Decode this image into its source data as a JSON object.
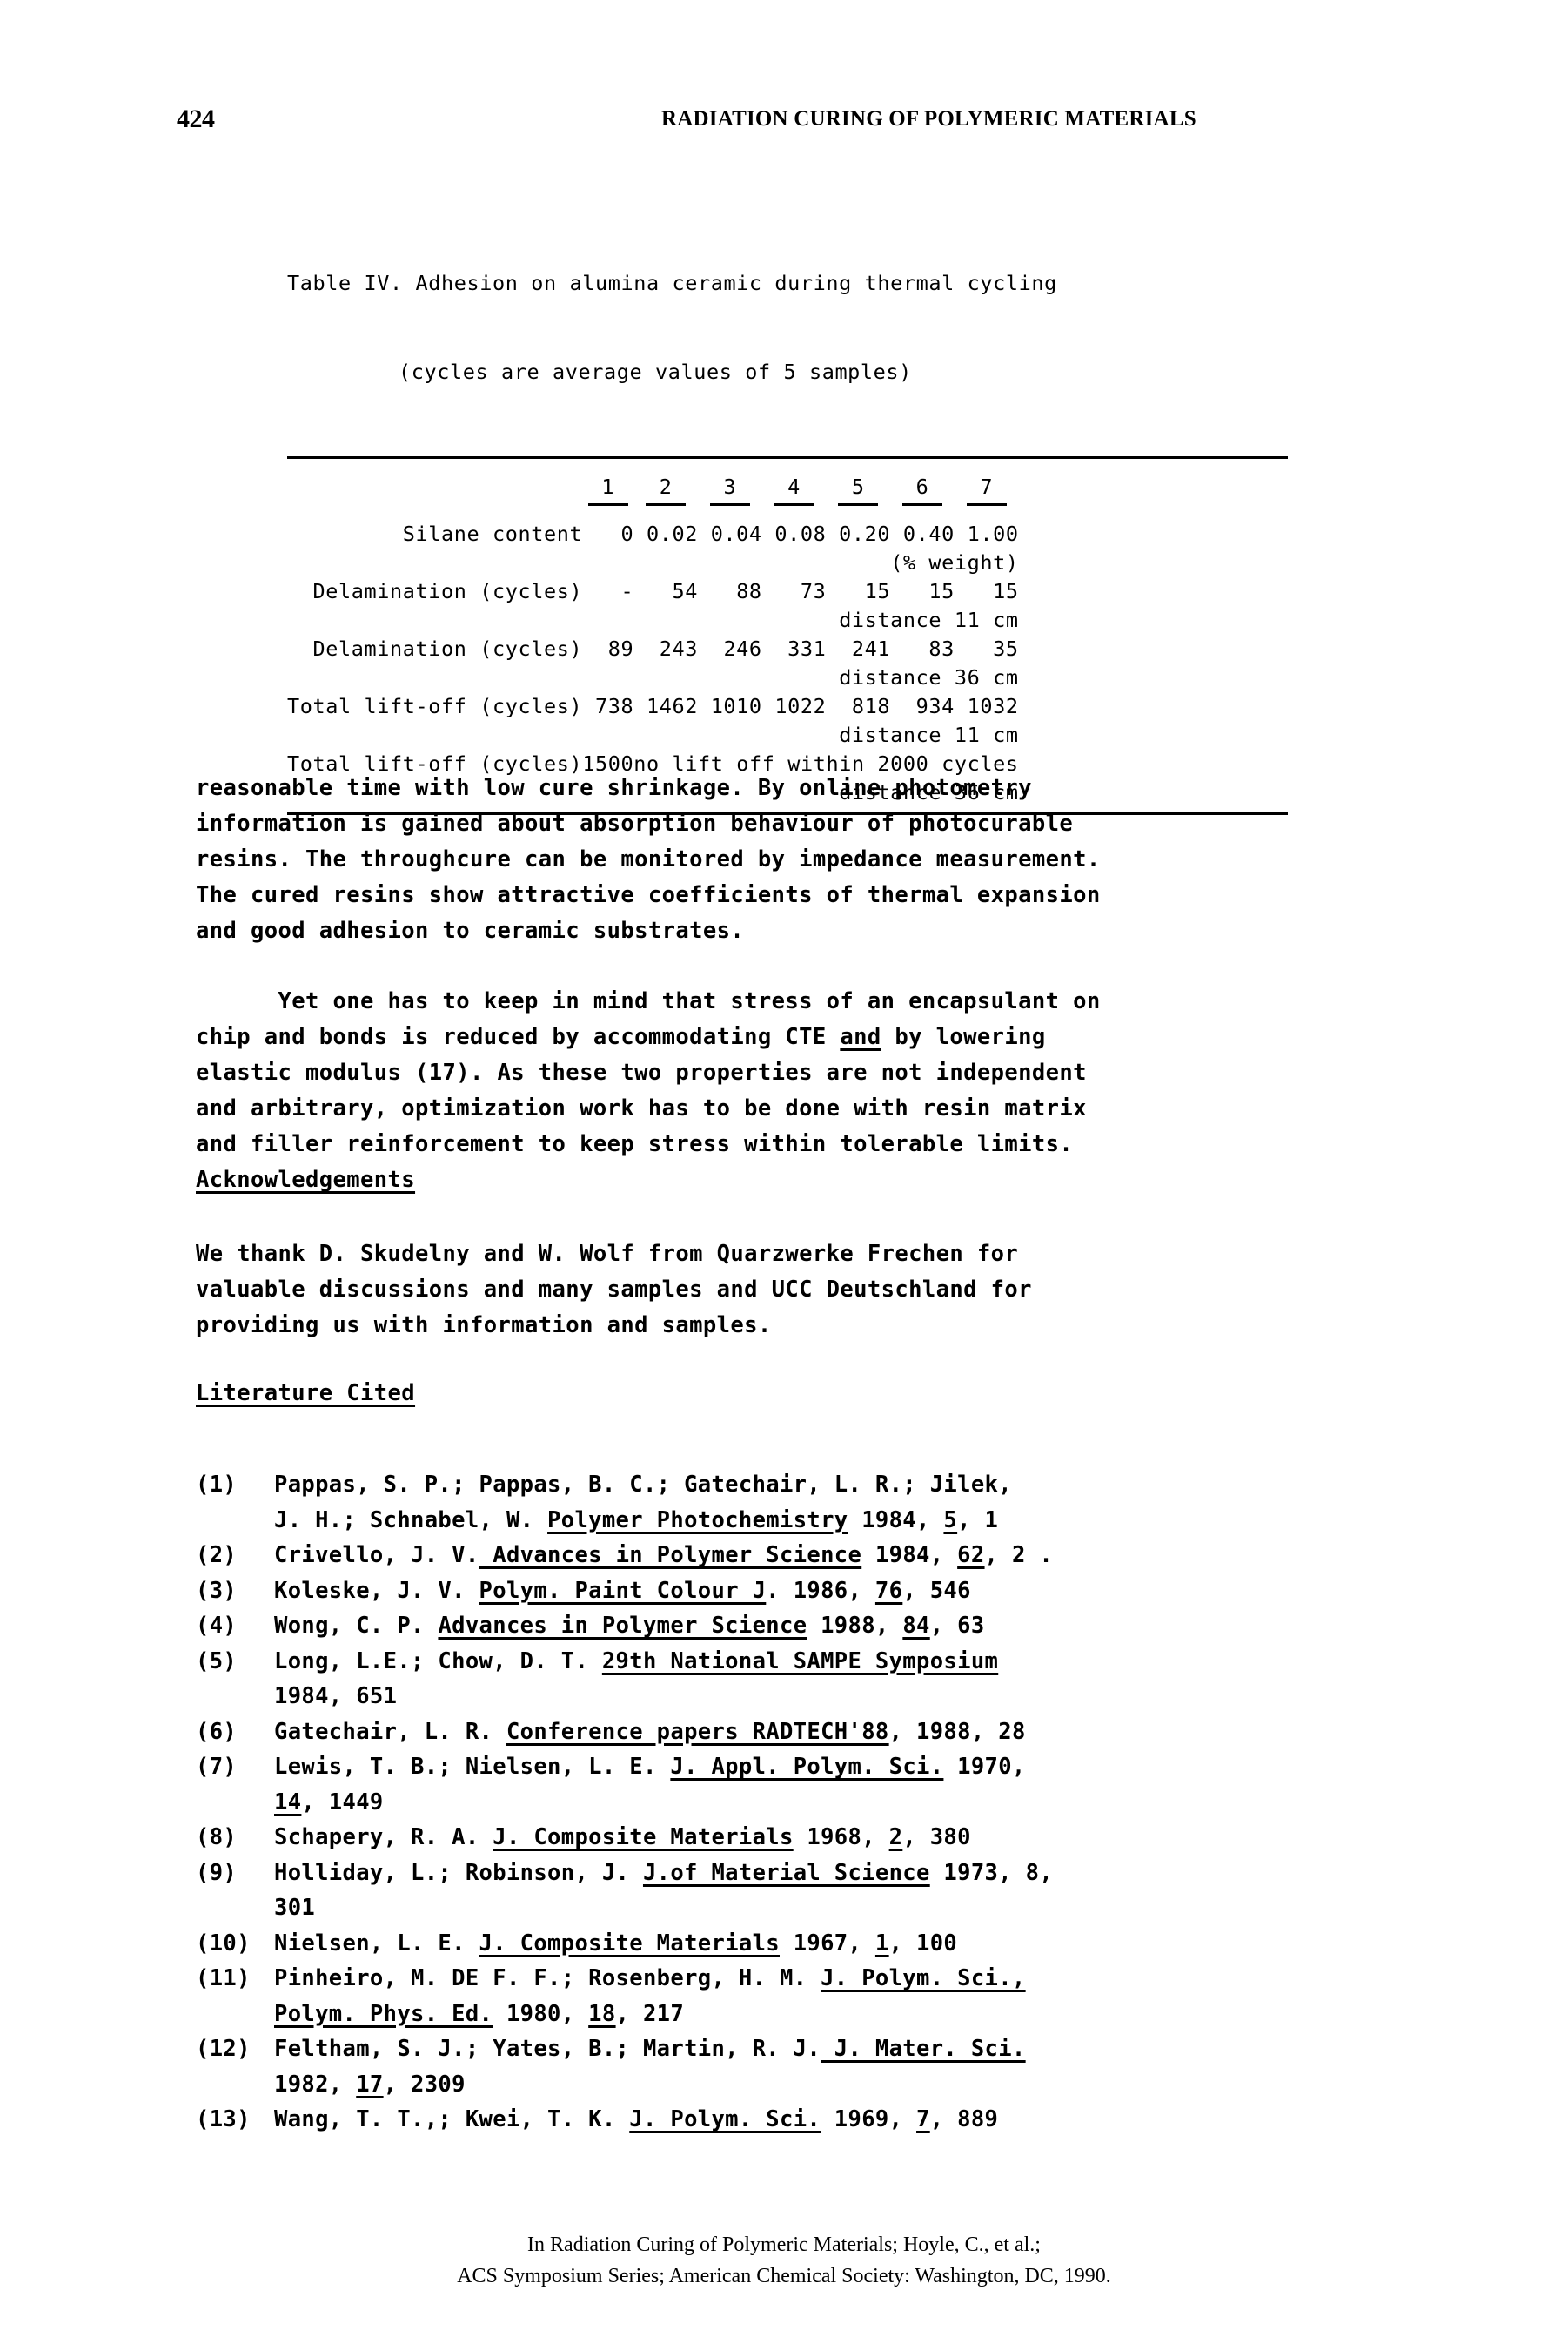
{
  "running_head": {
    "page_number": "424",
    "title": "RADIATION CURING OF POLYMERIC MATERIALS"
  },
  "table": {
    "caption_line1": "Table IV. Adhesion on alumina ceramic during thermal cycling",
    "caption_line2": "(cycles are average values of 5 samples)",
    "column_headers": [
      "1",
      "2",
      "3",
      "4",
      "5",
      "6",
      "7"
    ],
    "rows": [
      {
        "label": "Silane content",
        "sub_label": "(% weight)",
        "values": [
          "0",
          "0.02",
          "0.04",
          "0.08",
          "0.20",
          "0.40",
          "1.00"
        ]
      },
      {
        "label": "Delamination (cycles)",
        "sub_label": "distance 11 cm",
        "values": [
          "-",
          "54",
          "88",
          "73",
          "15",
          "15",
          "15"
        ]
      },
      {
        "label": "Delamination (cycles)",
        "sub_label": "distance 36 cm",
        "values": [
          "89",
          "243",
          "246",
          "331",
          "241",
          "83",
          "35"
        ]
      },
      {
        "label": "Total lift-off (cycles)",
        "sub_label": "distance 11 cm",
        "values": [
          "738",
          "1462",
          "1010",
          "1022",
          "818",
          "934",
          "1032"
        ]
      },
      {
        "label": "Total lift-off (cycles)",
        "sub_label": "distance 36 cm",
        "values": [
          "1500"
        ],
        "note": "no lift off within 2000 cycles"
      }
    ]
  },
  "body": {
    "paragraph_1": "reasonable time with low cure shrinkage. By online photometry\ninformation is gained about absorption behaviour of photocurable\nresins. The throughcure can be monitored by impedance measurement.\nThe cured resins show attractive coefficients of thermal expansion\nand good adhesion to ceramic substrates.",
    "paragraph_2_part1": "      Yet one has to keep in mind that stress of an encapsulant on\nchip and bonds is reduced by accommodating CTE ",
    "paragraph_2_underlined": "and",
    "paragraph_2_part2": " by lowering\nelastic modulus (17). As these two properties are not independent\nand arbitrary, optimization work has to be done with resin matrix\nand filler reinforcement to keep stress within tolerable limits."
  },
  "acknowledgements": {
    "heading": "Acknowledgements",
    "text": "We thank D. Skudelny and W. Wolf from Quarzwerke Frechen for\nvaluable discussions and many samples and UCC Deutschland for\nproviding us with information and samples."
  },
  "literature": {
    "heading": "Literature Cited",
    "references": [
      {
        "num": "(1)",
        "parts": [
          {
            "t": "Pappas, S. P.; Pappas, B. C.; Gatechair, L. R.; Jilek,\nJ. H.; Schnabel, W. ",
            "u": false
          },
          {
            "t": "Polymer Photochemistry",
            "u": true
          },
          {
            "t": " 1984, ",
            "u": false
          },
          {
            "t": "5",
            "u": true
          },
          {
            "t": ", 1",
            "u": false
          }
        ]
      },
      {
        "num": "(2)",
        "parts": [
          {
            "t": "Crivello, J. V.",
            "u": false
          },
          {
            "t": " Advances in Polymer Science",
            "u": true
          },
          {
            "t": " 1984, ",
            "u": false
          },
          {
            "t": "62",
            "u": true
          },
          {
            "t": ", 2 .",
            "u": false
          }
        ]
      },
      {
        "num": "(3)",
        "parts": [
          {
            "t": "Koleske, J. V. ",
            "u": false
          },
          {
            "t": "Polym. Paint Colour J",
            "u": true
          },
          {
            "t": ". 1986, ",
            "u": false
          },
          {
            "t": "76",
            "u": true
          },
          {
            "t": ", 546",
            "u": false
          }
        ]
      },
      {
        "num": "(4)",
        "parts": [
          {
            "t": "Wong, C. P. ",
            "u": false
          },
          {
            "t": "Advances in Polymer Science",
            "u": true
          },
          {
            "t": " 1988, ",
            "u": false
          },
          {
            "t": "84",
            "u": true
          },
          {
            "t": ", 63",
            "u": false
          }
        ]
      },
      {
        "num": "(5)",
        "parts": [
          {
            "t": "Long, L.E.; Chow, D. T. ",
            "u": false
          },
          {
            "t": "29th National SAMPE Symposium",
            "u": true
          },
          {
            "t": "\n1984, 651",
            "u": false
          }
        ]
      },
      {
        "num": "(6)",
        "parts": [
          {
            "t": "Gatechair, L. R. ",
            "u": false
          },
          {
            "t": "Conference papers RADTECH'88",
            "u": true
          },
          {
            "t": ", 1988, 28",
            "u": false
          }
        ]
      },
      {
        "num": "(7)",
        "parts": [
          {
            "t": "Lewis, T. B.; Nielsen, L. E. ",
            "u": false
          },
          {
            "t": "J. Appl. Polym. Sci.",
            "u": true
          },
          {
            "t": " 1970,\n",
            "u": false
          },
          {
            "t": "14",
            "u": true
          },
          {
            "t": ", 1449",
            "u": false
          }
        ]
      },
      {
        "num": "(8)",
        "parts": [
          {
            "t": "Schapery, R. A. ",
            "u": false
          },
          {
            "t": "J. Composite Materials",
            "u": true
          },
          {
            "t": " 1968, ",
            "u": false
          },
          {
            "t": "2",
            "u": true
          },
          {
            "t": ", 380",
            "u": false
          }
        ]
      },
      {
        "num": "(9)",
        "parts": [
          {
            "t": "Holliday, L.; Robinson, J. ",
            "u": false
          },
          {
            "t": "J.of Material Science",
            "u": true
          },
          {
            "t": " 1973, 8,\n301",
            "u": false
          }
        ]
      },
      {
        "num": "(10)",
        "parts": [
          {
            "t": "Nielsen, L. E. ",
            "u": false
          },
          {
            "t": "J. Composite Materials",
            "u": true
          },
          {
            "t": " 1967, ",
            "u": false
          },
          {
            "t": "1",
            "u": true
          },
          {
            "t": ", 100",
            "u": false
          }
        ]
      },
      {
        "num": "(11)",
        "parts": [
          {
            "t": "Pinheiro, M. DE F. F.; Rosenberg, H. M. ",
            "u": false
          },
          {
            "t": "J. Polym. Sci.,",
            "u": true
          },
          {
            "t": "\n",
            "u": false
          },
          {
            "t": "Polym. Phys. Ed.",
            "u": true
          },
          {
            "t": " 1980, ",
            "u": false
          },
          {
            "t": "18",
            "u": true
          },
          {
            "t": ", 217",
            "u": false
          }
        ]
      },
      {
        "num": "(12)",
        "parts": [
          {
            "t": "Feltham, S. J.; Yates, B.; Martin, R. J.",
            "u": false
          },
          {
            "t": " J. Mater. Sci.",
            "u": true
          },
          {
            "t": "\n1982, ",
            "u": false
          },
          {
            "t": "17",
            "u": true
          },
          {
            "t": ", 2309",
            "u": false
          }
        ]
      },
      {
        "num": "(13)",
        "parts": [
          {
            "t": "Wang, T. T.,; Kwei, T. K. ",
            "u": false
          },
          {
            "t": "J. Polym. Sci.",
            "u": true
          },
          {
            "t": " 1969, ",
            "u": false
          },
          {
            "t": "7",
            "u": true
          },
          {
            "t": ", 889",
            "u": false
          }
        ]
      }
    ]
  },
  "footer": {
    "line1": "In Radiation Curing of Polymeric Materials; Hoyle, C., et al.;",
    "line2": "ACS Symposium Series; American Chemical Society: Washington, DC, 1990."
  }
}
